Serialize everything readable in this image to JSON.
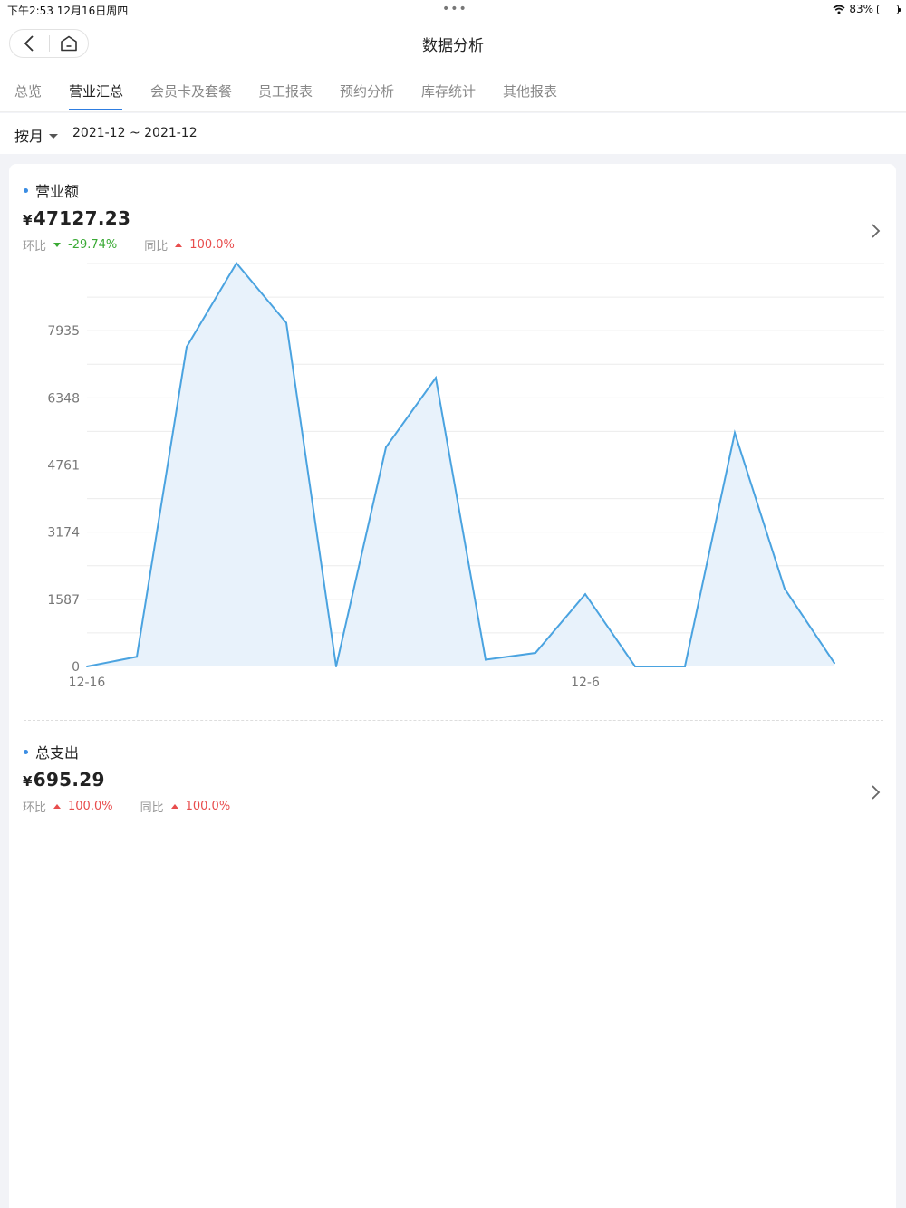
{
  "status_bar": {
    "time": "下午2:53   12月16日周四",
    "dots": "•••",
    "battery": "83%",
    "battery_level": 0.83
  },
  "nav": {
    "title": "数据分析",
    "back_icon": "chevron-left-icon",
    "home_icon": "home-icon"
  },
  "tabs": [
    "总览",
    "营业汇总",
    "会员卡及套餐",
    "员工报表",
    "预约分析",
    "库存统计",
    "其他报表"
  ],
  "active_tab": 1,
  "filter": {
    "mode": "按月",
    "range": "2021-12 ~ 2021-12"
  },
  "revenue": {
    "title": "营业额",
    "currency": "¥",
    "amount": "47127.23",
    "mom_label": "环比",
    "mom_value": "-29.74%",
    "yoy_label": "同比",
    "yoy_value": "100.0%"
  },
  "expense": {
    "title": "总支出",
    "currency": "¥",
    "amount": "695.29",
    "mom_label": "环比",
    "mom_value": "100.0%",
    "yoy_label": "同比",
    "yoy_value": "100.0%"
  },
  "colors": {
    "line": "#4aa3e0",
    "area": "#e8f2fb",
    "positive": "#3aaa35",
    "negative": "#e84d4d",
    "accent": "#2e7de1"
  },
  "chart_data": {
    "type": "area",
    "title": "",
    "xlabel": "",
    "ylabel": "",
    "ylim": [
      0,
      9522
    ],
    "yticks": [
      0,
      1587,
      3174,
      4761,
      6348,
      7935
    ],
    "x": [
      "12-16",
      "",
      "",
      "",
      "",
      "",
      "",
      "",
      "",
      "",
      "12-6",
      "",
      "",
      "",
      "",
      ""
    ],
    "x_tick_labels": [
      "12-16",
      "12-6"
    ],
    "x_tick_indices": [
      0,
      10
    ],
    "series": [
      {
        "values": [
          0,
          230,
          7550,
          9530,
          8120,
          0,
          5180,
          6820,
          160,
          320,
          1710,
          0,
          0,
          5520,
          1840,
          80
        ]
      }
    ],
    "grid": true,
    "legend": "none"
  }
}
